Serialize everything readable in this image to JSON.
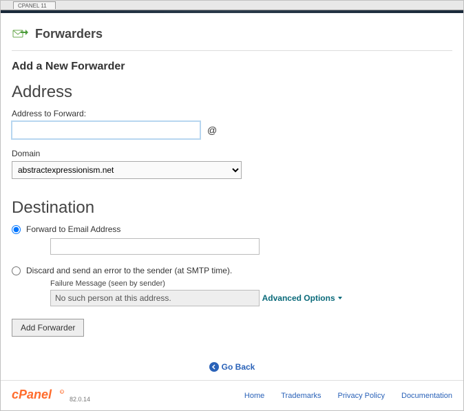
{
  "top_tab": "CPANEL 11",
  "page_title": "Forwarders",
  "section_heading": "Add a New Forwarder",
  "address": {
    "heading": "Address",
    "label": "Address to Forward:",
    "input_value": "",
    "at": "@",
    "domain_label": "Domain",
    "domain_selected": "abstractexpressionism.net"
  },
  "destination": {
    "heading": "Destination",
    "forward_label": "Forward to Email Address",
    "forward_value": "",
    "discard_label": "Discard and send an error to the sender (at SMTP time).",
    "failure_label": "Failure Message (seen by sender)",
    "failure_value": "No such person at this address."
  },
  "advanced_options": "Advanced Options",
  "add_button": "Add Forwarder",
  "go_back": "Go Back",
  "footer": {
    "version": "82.0.14",
    "links": {
      "home": "Home",
      "trademarks": "Trademarks",
      "privacy": "Privacy Policy",
      "docs": "Documentation"
    }
  }
}
